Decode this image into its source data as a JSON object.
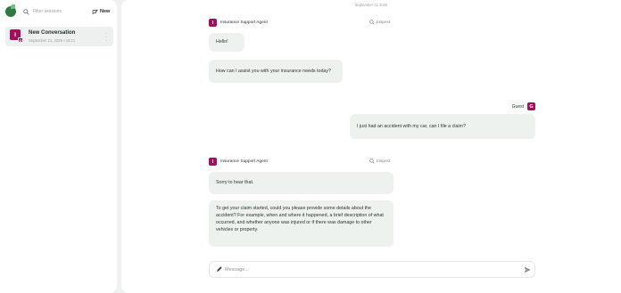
{
  "sidebar": {
    "search": {
      "placeholder": "Filter sessions"
    },
    "new_button_label": "New",
    "conversations": [
      {
        "avatar_letter": "I",
        "badge_letter": "G",
        "title": "New Conversation",
        "subtitle": "September 21, 2025 • 15:21"
      }
    ]
  },
  "chat": {
    "date_label": "September 21 2025",
    "messages": [
      {
        "sender": "Insurance Support Agent",
        "avatar_letter": "I",
        "inspect_label": "Inspect",
        "bubbles": [
          "Hello!",
          "How can I assist you with your insurance needs today?"
        ]
      },
      {
        "sender": "Guest",
        "avatar_letter": "G",
        "bubbles": [
          "I just had an accident with my car, can I file a claim?"
        ]
      },
      {
        "sender": "Insurance Support Agent",
        "avatar_letter": "I",
        "inspect_label": "Inspect",
        "bubbles": [
          "Sorry to hear that.",
          "To get your claim started, could you please provide some details about the accident? For example, when and where it happened, a brief description of what occurred, and whether anyone was injured or if there was damage to other vehicles or property."
        ]
      }
    ]
  },
  "composer": {
    "placeholder": "Message..."
  },
  "colors": {
    "avatar": "#a30f5b",
    "bubble": "#eef2ef",
    "background": "#eff2f0",
    "logo": "#2f7a3f"
  },
  "icons": [
    "logo-icon",
    "search-icon",
    "new-chat-icon",
    "more-icon",
    "inspect-icon",
    "pen-icon",
    "send-icon"
  ]
}
